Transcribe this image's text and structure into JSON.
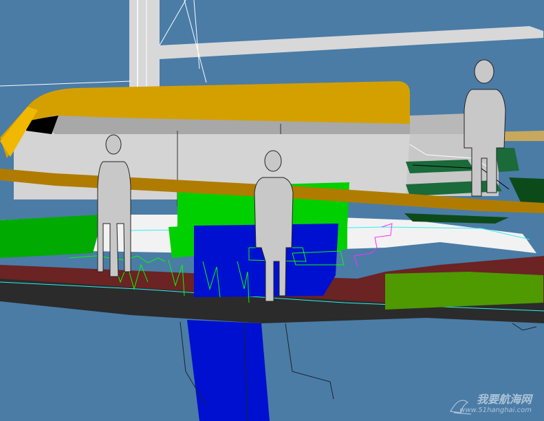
{
  "scene": {
    "background_color": "#4a7ca6",
    "subject": "sailboat-deck-model",
    "colors": {
      "hull_dark": "#2a2a2a",
      "hull_band": "#6b2323",
      "deck_white": "#f2f2f2",
      "cabin_gray": "#d4d4d4",
      "trim_gold": "#d4a000",
      "rail_brown": "#b07c00",
      "cushion_green": "#00c000",
      "cushion_blue": "#0010d0",
      "dark_green": "#1a6a3a",
      "olive_green": "#4e9a00",
      "figure_gray": "#c8c8c8",
      "sail_gray": "#d8d8d8"
    }
  },
  "watermark": {
    "text": "我要航海网",
    "url": "www.51hanghai.com"
  }
}
